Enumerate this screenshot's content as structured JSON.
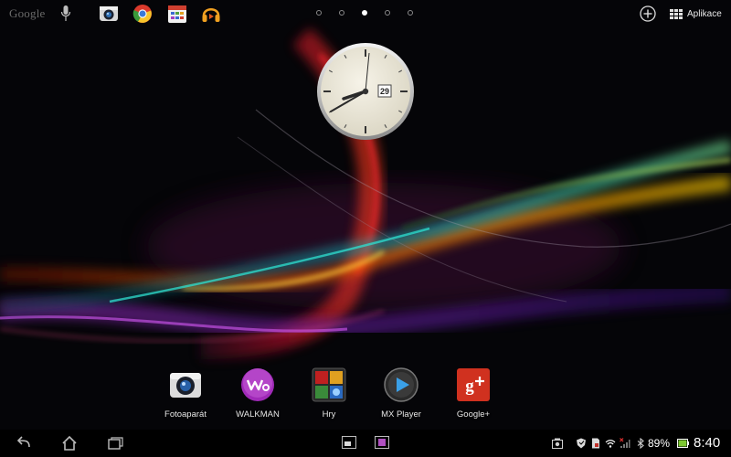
{
  "topbar": {
    "search_logo": "Google",
    "apps_label": "Aplikace",
    "page_indicator": {
      "count": 5,
      "active": 3
    }
  },
  "clock_widget": {
    "date": "29"
  },
  "dock": {
    "items": [
      {
        "label": "Fotoaparát",
        "icon": "camera-icon"
      },
      {
        "label": "WALKMAN",
        "icon": "walkman-icon"
      },
      {
        "label": "Hry",
        "icon": "games-folder-icon"
      },
      {
        "label": "MX Player",
        "icon": "mx-player-icon"
      },
      {
        "label": "Google+",
        "icon": "google-plus-icon"
      }
    ]
  },
  "status_bar": {
    "battery_percent": "89%",
    "time": "8:40",
    "battery_color": "#7dc832"
  },
  "colors": {
    "google_plus": "#d0311f",
    "walkman": "#a02ab8"
  }
}
